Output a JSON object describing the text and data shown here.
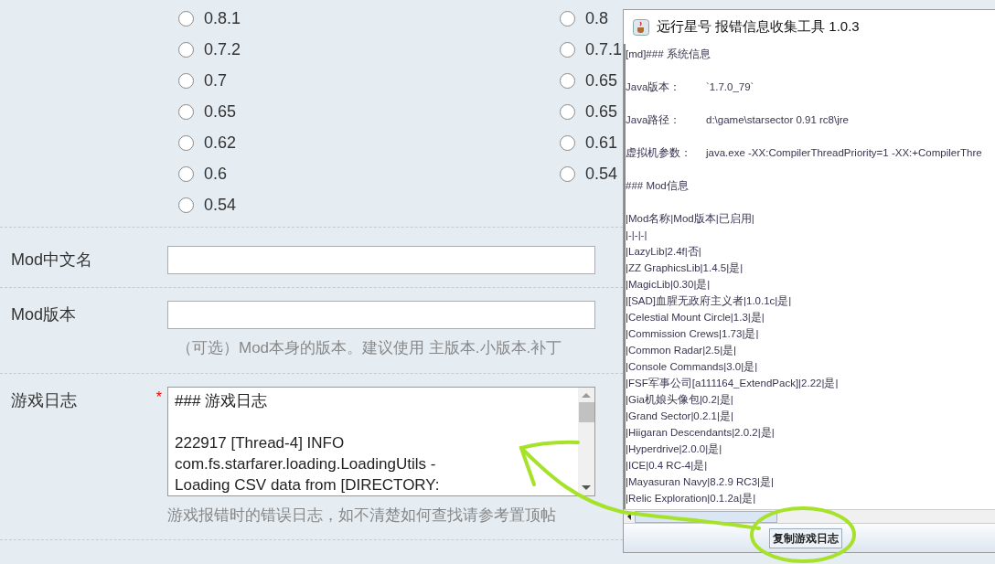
{
  "form": {
    "version_options": {
      "column_1": [
        {
          "label": "0.8.1",
          "selected": false
        },
        {
          "label": "0.7.2",
          "selected": false
        },
        {
          "label": "0.7",
          "selected": false
        },
        {
          "label": "0.65",
          "selected": false
        },
        {
          "label": "0.62",
          "selected": false
        },
        {
          "label": "0.6",
          "selected": false
        },
        {
          "label": "0.54",
          "selected": false
        }
      ],
      "column_2": [
        {
          "label": "0.8",
          "selected": false
        },
        {
          "label": "0.7.1",
          "selected": false
        },
        {
          "label": "0.65",
          "selected": false
        },
        {
          "label": "0.65",
          "selected": false
        },
        {
          "label": "0.61",
          "selected": false
        },
        {
          "label": "0.54",
          "selected": false
        }
      ]
    },
    "fields": [
      {
        "kind": "input",
        "label": "Mod中文名"
      },
      {
        "kind": "input",
        "label": "Mod版本",
        "hint": "（可选）Mod本身的版本。建议使用 主版本.小版本.补丁"
      },
      {
        "kind": "textarea",
        "label": "游戏日志",
        "required_mark": "*",
        "value_paragraphs": [
          [
            "### 游戏日志"
          ],
          [
            "222917 [Thread-4] INFO",
            "com.fs.starfarer.loading.LoadingUtils  -",
            "Loading CSV data from [DIRECTORY:"
          ]
        ],
        "hint": "游戏报错时的错误日志，如不清楚如何查找请参考置顶帖"
      }
    ]
  },
  "window": {
    "title": "远行星号 报错信息收集工具 1.0.3",
    "lines": [
      {
        "kind": "heading",
        "text": "[md]### 系统信息"
      },
      {
        "kind": "pair",
        "label": "Java版本：",
        "value": "`1.7.0_79`"
      },
      {
        "kind": "pair",
        "label": "Java路径：",
        "value": "d:\\game\\starsector 0.91 rc8\\jre"
      },
      {
        "kind": "pair",
        "label": "虚拟机参数：",
        "value": "java.exe -XX:CompilerThreadPriority=1 -XX:+CompilerThre"
      },
      {
        "kind": "heading",
        "text": "### Mod信息"
      },
      {
        "kind": "row",
        "text": "|Mod名称|Mod版本|已启用|"
      },
      {
        "kind": "row",
        "text": "|-|-|-|"
      },
      {
        "kind": "row",
        "text": "|LazyLib|2.4f|否|"
      },
      {
        "kind": "row",
        "text": "|ZZ GraphicsLib|1.4.5|是|"
      },
      {
        "kind": "row",
        "text": "|MagicLib|0.30|是|"
      },
      {
        "kind": "row",
        "text": "|[SAD]血腥无政府主义者|1.0.1c|是|"
      },
      {
        "kind": "row",
        "text": "|Celestial Mount Circle|1.3|是|"
      },
      {
        "kind": "row",
        "text": "|Commission Crews|1.73|是|"
      },
      {
        "kind": "row",
        "text": "|Common Radar|2.5|是|"
      },
      {
        "kind": "row",
        "text": "|Console Commands|3.0|是|"
      },
      {
        "kind": "row",
        "text": "|FSF军事公司[a111164_ExtendPack]|2.22|是|"
      },
      {
        "kind": "row",
        "text": "|Gia机娘头像包|0.2|是|"
      },
      {
        "kind": "row",
        "text": "|Grand Sector|0.2.1|是|"
      },
      {
        "kind": "row",
        "text": "|Hiigaran Descendants|2.0.2|是|"
      },
      {
        "kind": "row",
        "text": "|Hyperdrive|2.0.0|是|"
      },
      {
        "kind": "row",
        "text": "|ICE|0.4 RC-4|是|"
      },
      {
        "kind": "row",
        "text": "|Mayasuran Navy|8.2.9 RC3|是|"
      },
      {
        "kind": "row",
        "text": "|Relic Exploration|0.1.2a|是|"
      }
    ],
    "button": "复制游戏日志"
  }
}
